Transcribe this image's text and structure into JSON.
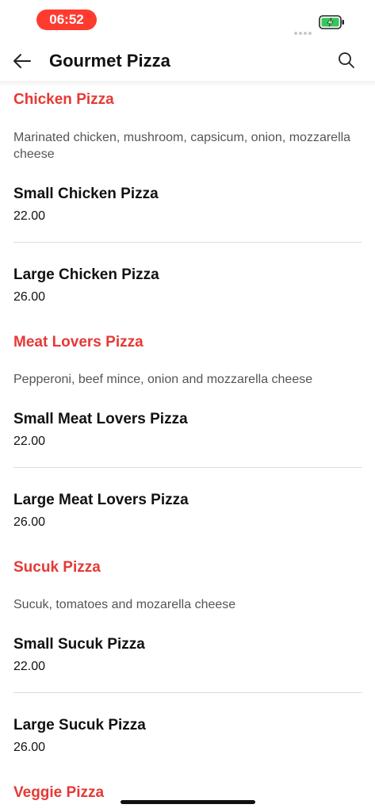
{
  "status": {
    "time": "06:52",
    "accent": "#ff3b30",
    "battery_color": "#34c759"
  },
  "header": {
    "title": "Gourmet Pizza",
    "back_icon": "arrow-left-icon",
    "search_icon": "search-icon"
  },
  "colors": {
    "category": "#e53935"
  },
  "categories": [
    {
      "title": "Chicken Pizza",
      "description": "Marinated chicken, mushroom, capsicum, onion, mozzarella cheese",
      "items": [
        {
          "name": "Small Chicken Pizza",
          "price": "22.00"
        },
        {
          "name": "Large Chicken Pizza",
          "price": "26.00"
        }
      ]
    },
    {
      "title": "Meat Lovers Pizza",
      "description": "Pepperoni, beef mince, onion and mozzarella cheese",
      "items": [
        {
          "name": "Small Meat Lovers Pizza",
          "price": "22.00"
        },
        {
          "name": "Large Meat Lovers Pizza",
          "price": "26.00"
        }
      ]
    },
    {
      "title": "Sucuk Pizza",
      "description": "Sucuk, tomatoes and mozarella cheese",
      "items": [
        {
          "name": "Small Sucuk Pizza",
          "price": "22.00"
        },
        {
          "name": "Large Sucuk Pizza",
          "price": "26.00"
        }
      ]
    },
    {
      "title": "Veggie Pizza"
    }
  ]
}
